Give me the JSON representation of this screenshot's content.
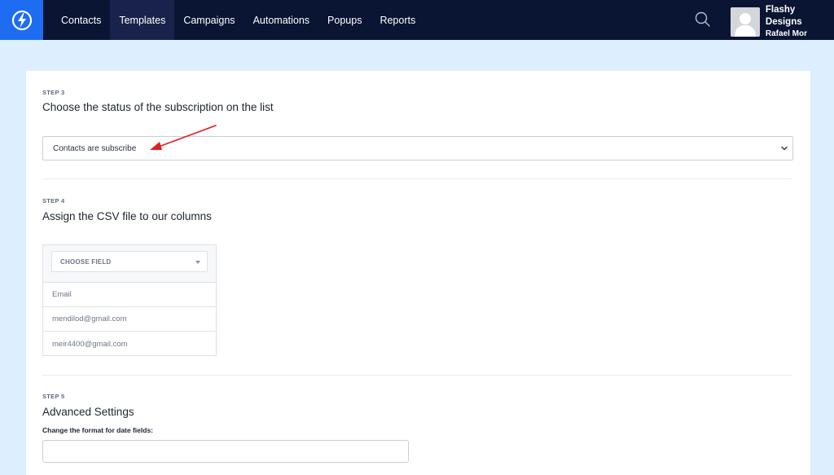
{
  "topbar": {
    "logo_icon": "lightning-bolt-icon",
    "nav": [
      {
        "label": "Contacts",
        "active": false
      },
      {
        "label": "Templates",
        "active": true
      },
      {
        "label": "Campaigns",
        "active": false
      },
      {
        "label": "Automations",
        "active": false
      },
      {
        "label": "Popups",
        "active": false
      },
      {
        "label": "Reports",
        "active": false
      }
    ],
    "search_icon": "search-icon",
    "user": {
      "name": "Flashy Designs",
      "subtitle": "Rafael Mor",
      "avatar_icon": "avatar-placeholder-icon"
    }
  },
  "step3": {
    "step": "STEP 3",
    "title": "Choose the status of the subscription on the list",
    "select_value": "Contacts are subscribe",
    "annotation": "red-arrow"
  },
  "step4": {
    "step": "STEP 4",
    "title": "Assign the CSV file to our columns",
    "field_placeholder": "CHOOSE FIELD",
    "rows": [
      "Email",
      "mendilod@gmail.com",
      "meir4400@gmail.com"
    ]
  },
  "step5": {
    "step": "STEP 5",
    "title": "Advanced Settings",
    "date_label": "Change the format for date fields:",
    "date_value": ""
  },
  "colors": {
    "nav_bg": "#0a1433",
    "brand": "#1d6cf2",
    "page_bg": "#ddeefe",
    "annotation": "#e02020"
  }
}
